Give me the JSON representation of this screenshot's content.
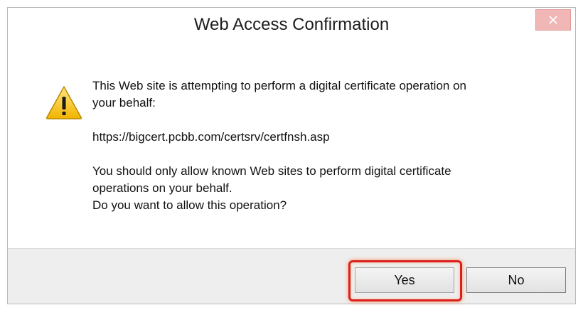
{
  "window": {
    "title": "Web Access Confirmation",
    "close_icon": "close-icon",
    "close_color": "#f1b7b7"
  },
  "message": {
    "line1": "This Web site is attempting to perform a digital certificate operation on",
    "line2": "your behalf:",
    "url": "https://bigcert.pcbb.com/certsrv/certfnsh.asp",
    "line3": "You should only allow known Web sites to perform digital certificate",
    "line4": "operations on your behalf.",
    "line5": "Do you want to allow this operation?",
    "icon": "warning-icon"
  },
  "buttons": {
    "yes_label": "Yes",
    "no_label": "No",
    "highlight_color": "#d9201c"
  }
}
